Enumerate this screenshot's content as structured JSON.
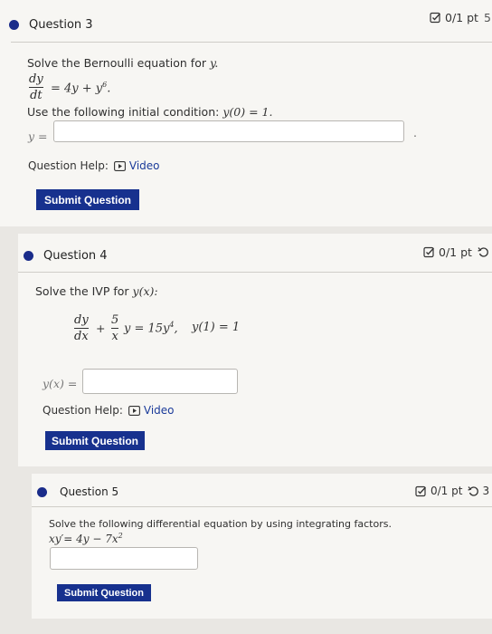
{
  "q3": {
    "title": "Question 3",
    "score": "0/1 pt",
    "prompt": "Solve the Bernoulli equation for",
    "var": "y.",
    "eq_num": "dy",
    "eq_den": "dt",
    "eq_rhs": "= 4y + y",
    "eq_exp": "6",
    "eq_end": ".",
    "condition_label": "Use the following initial condition:",
    "condition": "y(0) = 1.",
    "answer_label": "y =",
    "answer_value": "",
    "answer_suffix": ".",
    "help_label": "Question Help:",
    "video_label": "Video",
    "submit_label": "Submit Question"
  },
  "q4": {
    "title": "Question 4",
    "score": "0/1 pt",
    "prompt": "Solve the IVP for",
    "var": "y(x):",
    "eq_num1": "dy",
    "eq_den1": "dx",
    "eq_plus": "+",
    "eq_num2": "5",
    "eq_den2": "x",
    "eq_rhs": "y = 15y",
    "eq_exp": "4",
    "eq_comma": ",",
    "eq_init": "y(1) = 1",
    "answer_label": "y(x) =",
    "answer_value": "",
    "help_label": "Question Help:",
    "video_label": "Video",
    "submit_label": "Submit Question"
  },
  "q5": {
    "title": "Question 5",
    "score": "0/1 pt",
    "attempts": "3",
    "prompt": "Solve the following differential equation by using integrating factors.",
    "equation": "xy′= 4y − 7x",
    "eq_exp": "2",
    "answer_value": "",
    "submit_label": "Submit Question"
  },
  "partial_score_q3": "5",
  "colors": {
    "accent": "#17318e",
    "dot": "#1a2c8a",
    "video": "#1b3b9a"
  }
}
